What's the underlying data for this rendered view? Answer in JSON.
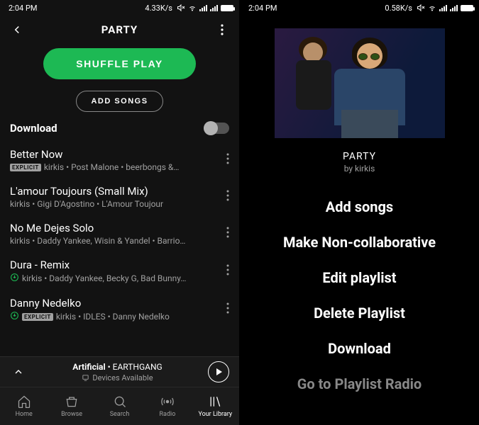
{
  "left": {
    "statusbar": {
      "time": "2:04 PM",
      "data_rate": "4.33K/s"
    },
    "header": {
      "title": "PARTY"
    },
    "buttons": {
      "shuffle": "SHUFFLE PLAY",
      "add_songs": "ADD SONGS"
    },
    "download_label": "Download",
    "tracks": [
      {
        "title": "Better Now",
        "explicit": true,
        "downloaded": false,
        "subtitle": "kirkis • Post Malone • beerbongs &…"
      },
      {
        "title": "L'amour Toujours (Small Mix)",
        "explicit": false,
        "downloaded": false,
        "subtitle": "kirkis • Gigi D'Agostino • L'Amour Toujour"
      },
      {
        "title": "No Me Dejes Solo",
        "explicit": false,
        "downloaded": false,
        "subtitle": "kirkis • Daddy Yankee, Wisin & Yandel • Barrio…"
      },
      {
        "title": "Dura - Remix",
        "explicit": false,
        "downloaded": true,
        "subtitle": "kirkis • Daddy Yankee, Becky G, Bad Bunny…"
      },
      {
        "title": "Danny Nedelko",
        "explicit": true,
        "downloaded": true,
        "subtitle": "kirkis • IDLES • Danny Nedelko"
      }
    ],
    "nowplaying": {
      "track": "Artificial",
      "artist": "EARTHGANG",
      "devices": "Devices Available"
    },
    "nav": {
      "home": "Home",
      "browse": "Browse",
      "search": "Search",
      "radio": "Radio",
      "library": "Your Library"
    }
  },
  "right": {
    "statusbar": {
      "time": "2:04 PM",
      "data_rate": "0.58K/s"
    },
    "playlist": {
      "title": "PARTY",
      "byline": "by kirkis"
    },
    "menu": {
      "add_songs": "Add songs",
      "make_non_collab": "Make Non-collaborative",
      "edit": "Edit playlist",
      "delete": "Delete Playlist",
      "download": "Download",
      "radio": "Go to Playlist Radio"
    }
  }
}
